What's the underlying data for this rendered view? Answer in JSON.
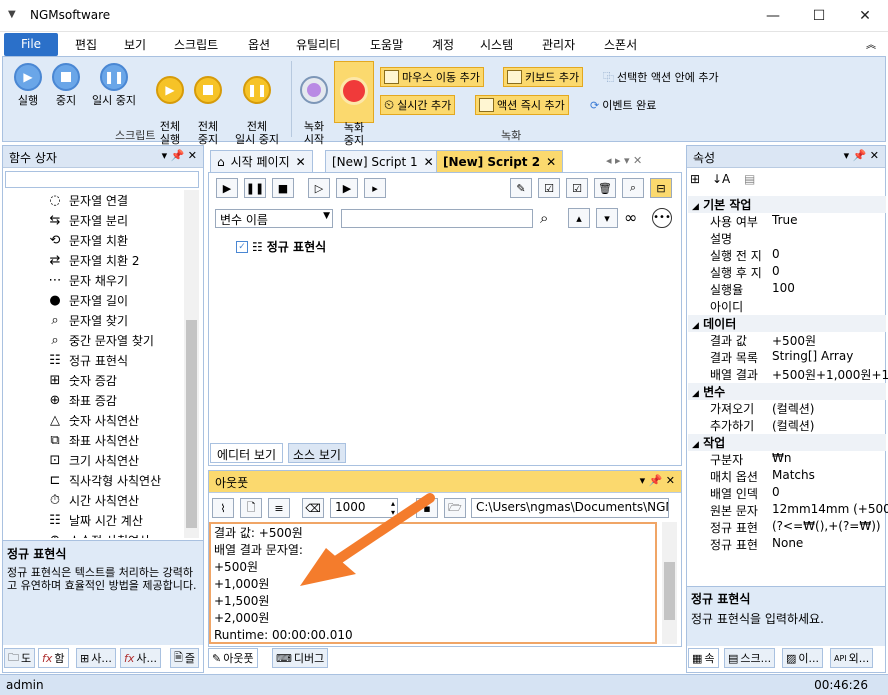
{
  "window": {
    "title": "NGMsoftware",
    "minimize": "—",
    "maximize": "☐",
    "close": "✕"
  },
  "menu": {
    "file": "File",
    "items": [
      "편집",
      "보기",
      "스크립트",
      "옵션",
      "유틸리티",
      "도움말",
      "계정",
      "시스템",
      "관리자",
      "스폰서"
    ],
    "active": "스크립트"
  },
  "ribbon": {
    "script_group": {
      "label": "스크립트",
      "run": "실행",
      "stop": "중지",
      "pause": "일시 중지",
      "run_all": "전체\n실행",
      "stop_all": "전체\n중지",
      "pause_all": "전체\n일시 중지"
    },
    "record_group": {
      "label": "녹화",
      "record_start": "녹화\n시작",
      "record_stop": "녹화\n중지",
      "mouse_move": "마우스 이동 추가",
      "keyboard": "키보드 추가",
      "selected_action": "선택한 액션 안에 추가",
      "realtime": "실시간 추가",
      "action_instant": "액션 즉시 추가",
      "event_done": "이벤트 완료"
    }
  },
  "left_panel": {
    "title": "함수 상자",
    "items": [
      "문자열 연결",
      "문자열 분리",
      "문자열 치환",
      "문자열 치환 2",
      "문자 채우기",
      "문자열 길이",
      "문자열 찾기",
      "중간 문자열 찾기",
      "정규 표현식",
      "숫자 증감",
      "좌표 증감",
      "숫자 사칙연산",
      "좌표 사칙연산",
      "크기 사칙연산",
      "직사각형 사칙연산",
      "시간 사칙연산",
      "날짜 시간 계산",
      "소수점 사칙연산"
    ],
    "desc_title": "정규 표현식",
    "desc_text": "정규 표현식은 텍스트를 처리하는 강력하고 유연하며 효율적인 방법을 제공합니다.",
    "bottom_tabs": [
      "도",
      "함",
      "사...",
      "사...",
      "즐"
    ]
  },
  "doc_tabs": [
    "시작 페이지",
    "[New] Script 1",
    "[New] Script 2"
  ],
  "editor": {
    "var_dropdown": "변수 이름",
    "search_value": "",
    "tree_item": "정규 표현식",
    "view_tabs": [
      "에디터 보기",
      "소스 보기"
    ]
  },
  "output": {
    "title": "아웃풋",
    "count": "1000",
    "path": "C:\\Users\\ngmas\\Documents\\NGM6\\",
    "lines": [
      "결과 값: +500원",
      "배열 결과 문자열:",
      "+500원",
      "+1,000원",
      "+1,500원",
      "+2,000원",
      "Runtime: 00:00:00.010"
    ],
    "bottom_tabs": [
      "아웃풋",
      "디버그"
    ]
  },
  "properties": {
    "title": "속성",
    "categories": [
      {
        "name": "기본 작업",
        "rows": [
          [
            "사용 여부",
            "True"
          ],
          [
            "설명",
            ""
          ],
          [
            "실행 전 지",
            "0"
          ],
          [
            "실행 후 지",
            "0"
          ],
          [
            "실행율",
            "100"
          ],
          [
            "아이디",
            ""
          ]
        ]
      },
      {
        "name": "데이터",
        "rows": [
          [
            "결과 값",
            "+500원"
          ],
          [
            "결과 목록",
            "String[] Array"
          ],
          [
            "배열 결과",
            "+500원+1,000원+1,500"
          ]
        ]
      },
      {
        "name": "변수",
        "rows": [
          [
            "가져오기",
            "(컬렉션)"
          ],
          [
            "추가하기",
            "(컬렉션)"
          ]
        ]
      },
      {
        "name": "작업",
        "rows": [
          [
            "구분자",
            "₩n"
          ],
          [
            "매치 옵션",
            "Matchs"
          ],
          [
            "배열 인덱",
            "0"
          ],
          [
            "원본 문자",
            "12mm14mm (+500"
          ],
          [
            "정규 표현",
            "(?<=₩(),+(?=₩))"
          ],
          [
            "정규 표현",
            "None"
          ]
        ]
      }
    ],
    "desc_title": "정규 표현식",
    "desc_text": "정규 표현식을 입력하세요.",
    "bottom_tabs": [
      "속",
      "스크...",
      "이...",
      "외..."
    ]
  },
  "status": {
    "user": "admin",
    "time": "00:46:26"
  },
  "colors": {
    "accent": "#2b70c9",
    "arrow": "#f47c2c",
    "highlight": "#fbd96e",
    "panel": "#dfeaf7"
  }
}
